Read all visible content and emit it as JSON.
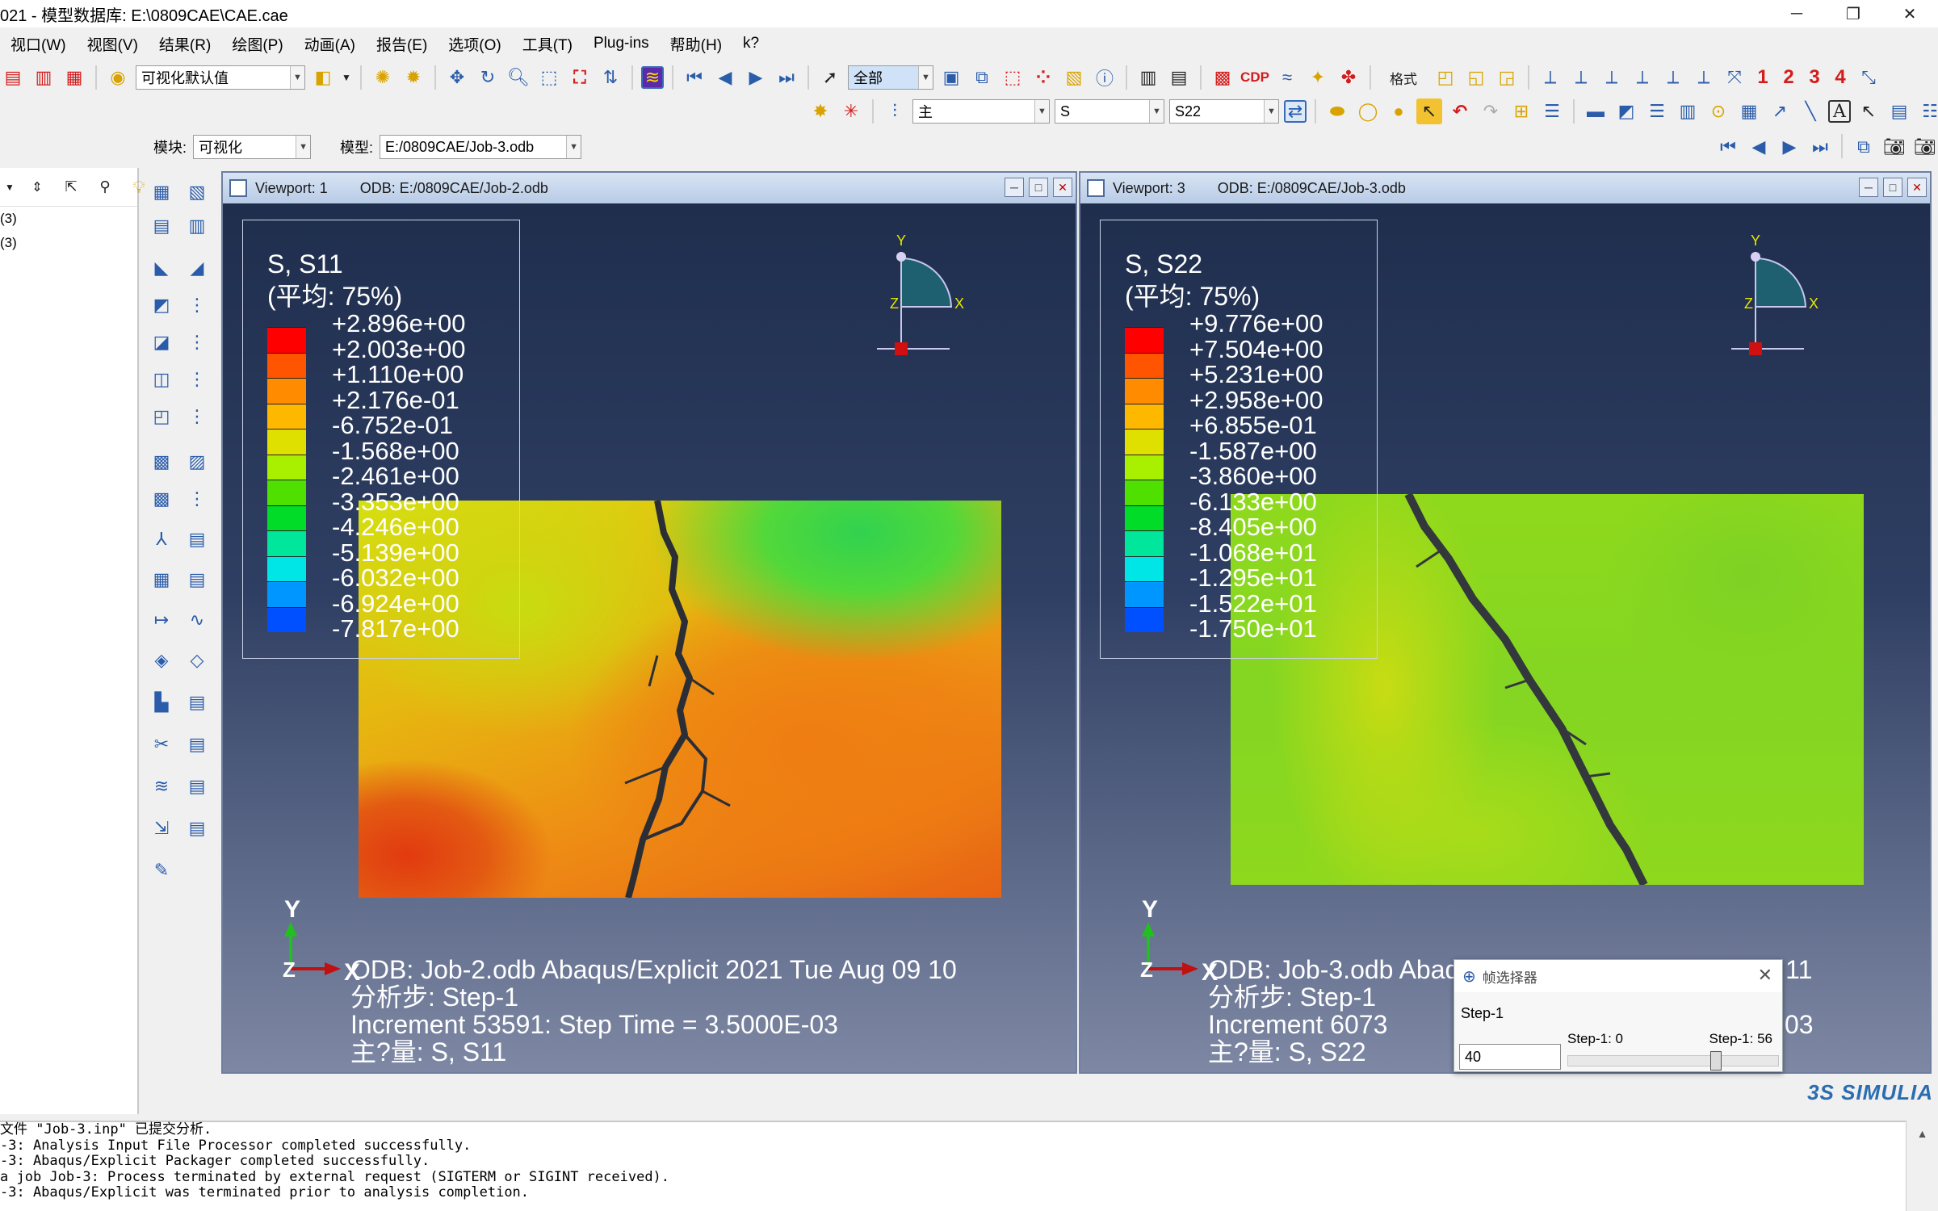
{
  "window": {
    "title": "021 - 模型数据库: E:\\0809CAE\\CAE.cae",
    "minimize_label": "─",
    "restore_label": "❐",
    "close_label": "✕"
  },
  "menus": [
    "视口(W)",
    "视图(V)",
    "结果(R)",
    "绘图(P)",
    "动画(A)",
    "报告(E)",
    "选项(O)",
    "工具(T)",
    "Plug-ins",
    "帮助(H)",
    "k?"
  ],
  "toolbar": {
    "style_combo": "可视化默认值",
    "selection_combo": "全部",
    "format_label": "格式",
    "view_numbers": [
      "1",
      "2",
      "3",
      "4"
    ],
    "cdp_label": "CDP",
    "field_primary": "主",
    "field_variable": "S",
    "field_component": "S22"
  },
  "context": {
    "module_label": "模块:",
    "module_value": "可视化",
    "model_label": "模型:",
    "model_value": "E:/0809CAE/Job-3.odb"
  },
  "tree": {
    "items": [
      "(3)",
      "(3)"
    ]
  },
  "viewports": [
    {
      "name": "Viewport: 1",
      "odb": "ODB: E:/0809CAE/Job-2.odb",
      "legend_title": "S, S11",
      "legend_avg": "(平均: 75%)",
      "legend_values": [
        "+2.896e+00",
        "+2.003e+00",
        "+1.110e+00",
        "+2.176e-01",
        "-6.752e-01",
        "-1.568e+00",
        "-2.461e+00",
        "-3.353e+00",
        "-4.246e+00",
        "-5.139e+00",
        "-6.032e+00",
        "-6.924e+00",
        "-7.817e+00"
      ],
      "info_line1": "ODB: Job-2.odb    Abaqus/Explicit 2021     Tue Aug 09 10",
      "info_line2": "分析步: Step-1",
      "info_line3": "Increment      53591: Step Time =    3.5000E-03",
      "info_line4": "主?量: S, S11",
      "triad": {
        "x": "X",
        "y": "Y",
        "z": "Z"
      }
    },
    {
      "name": "Viewport: 3",
      "odb": "ODB: E:/0809CAE/Job-3.odb",
      "legend_title": "S, S22",
      "legend_avg": "(平均: 75%)",
      "legend_values": [
        "+9.776e+00",
        "+7.504e+00",
        "+5.231e+00",
        "+2.958e+00",
        "+6.855e-01",
        "-1.587e+00",
        "-3.860e+00",
        "-6.133e+00",
        "-8.405e+00",
        "-1.068e+01",
        "-1.295e+01",
        "-1.522e+01",
        "-1.750e+01"
      ],
      "info_line1": "ODB: Job-3.odb    Abaqus/Explicit 2021     Tue Aug 09 11",
      "info_line2": "分析步: Step-1",
      "info_line3": "Increment      6073",
      "info_line3_tail": "03",
      "info_line4": "主?量: S, S22",
      "triad": {
        "x": "X",
        "y": "Y",
        "z": "Z"
      }
    }
  ],
  "legend_colors": [
    "#ff0000",
    "#ff5500",
    "#ff8c00",
    "#ffb800",
    "#e0e000",
    "#a8f000",
    "#50e000",
    "#00dc28",
    "#00e69a",
    "#00e6e6",
    "#0096ff",
    "#0050ff",
    "#0000ff"
  ],
  "frame_selector": {
    "title": "帧选择器",
    "step_label": "Step-1",
    "frame_value": "40",
    "slider_min_label": "Step-1: 0",
    "slider_max_label": "Step-1: 56",
    "frame_fraction": 0.714
  },
  "messages": [
    "文件 \"Job-3.inp\" 已提交分析.",
    "-3: Analysis Input File Processor completed successfully.",
    "-3: Abaqus/Explicit Packager completed successfully.",
    "a job Job-3: Process terminated by external request (SIGTERM or SIGINT received).",
    "-3: Abaqus/Explicit was terminated prior to analysis completion.",
    "                                                                            "
  ],
  "brand": "3S SIMULIA"
}
